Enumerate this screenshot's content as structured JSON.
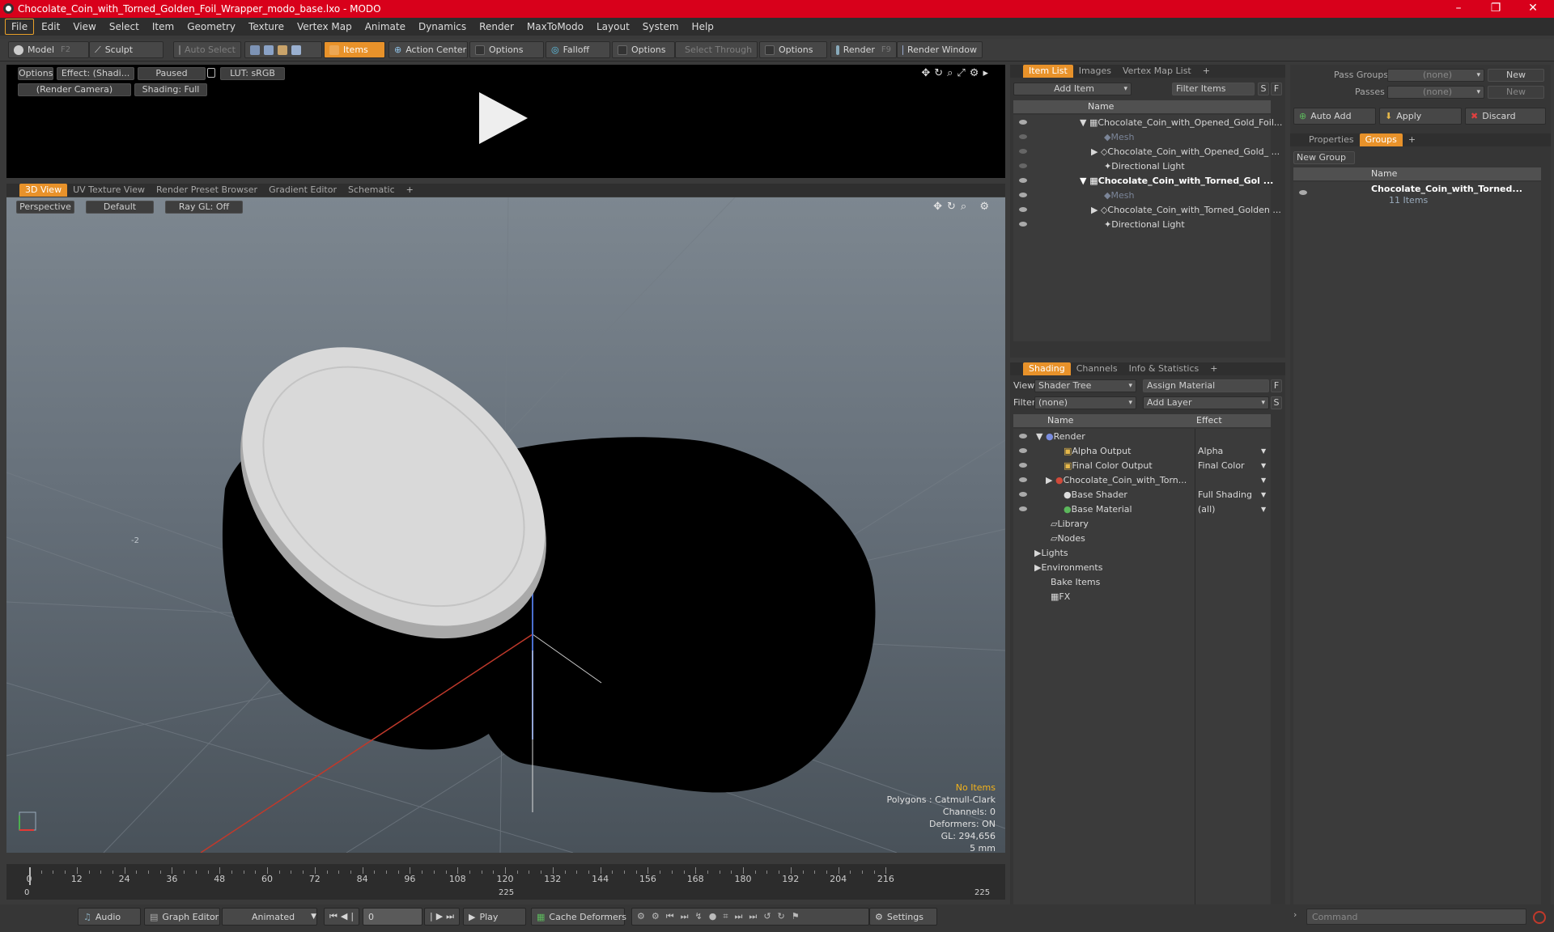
{
  "window": {
    "title": "Chocolate_Coin_with_Torned_Golden_Foil_Wrapper_modo_base.lxo - MODO"
  },
  "menu": [
    "File",
    "Edit",
    "View",
    "Select",
    "Item",
    "Geometry",
    "Texture",
    "Vertex Map",
    "Animate",
    "Dynamics",
    "Render",
    "MaxToModo",
    "Layout",
    "System",
    "Help"
  ],
  "toolbar": {
    "model": "Model",
    "model_key": "F2",
    "sculpt": "Sculpt",
    "auto_select": "Auto Select",
    "items": "Items",
    "action_center": "Action Center",
    "options1": "Options",
    "falloff": "Falloff",
    "options2": "Options",
    "select_through": "Select Through",
    "options3": "Options",
    "render": "Render",
    "render_key": "F9",
    "render_window": "Render Window"
  },
  "preview": {
    "options": "Options",
    "effect": "Effect: (Shadi...",
    "paused": "Paused",
    "lut": "LUT: sRGB",
    "camera": "(Render Camera)",
    "shading": "Shading: Full"
  },
  "viewport_tabs": [
    "3D View",
    "UV Texture View",
    "Render Preset Browser",
    "Gradient Editor",
    "Schematic"
  ],
  "viewport": {
    "view": "Perspective",
    "style": "Default",
    "raygl": "Ray GL: Off",
    "grid_label": "-2",
    "hud": {
      "no_items": "No Items",
      "polygons": "Polygons : Catmull-Clark",
      "channels": "Channels: 0",
      "deformers": "Deformers: ON",
      "gl": "GL: 294,656",
      "unit": "5 mm"
    }
  },
  "item_list": {
    "tabs": [
      "Item List",
      "Images",
      "Vertex Map List"
    ],
    "add_item": "Add Item",
    "filter": "Filter Items",
    "s": "S",
    "f": "F",
    "col_name": "Name",
    "rows": [
      "Chocolate_Coin_with_Opened_Gold_Foil...",
      "Mesh",
      "Chocolate_Coin_with_Opened_Gold_ ...",
      "Directional Light",
      "Chocolate_Coin_with_Torned_Gol ...",
      "Mesh",
      "Chocolate_Coin_with_Torned_Golden ...",
      "Directional Light"
    ]
  },
  "shading": {
    "tabs": [
      "Shading",
      "Channels",
      "Info & Statistics"
    ],
    "view_label": "View",
    "view_value": "Shader Tree",
    "assign": "Assign Material",
    "f": "F",
    "filter_label": "Filter",
    "filter_value": "(none)",
    "add_layer": "Add Layer",
    "s": "S",
    "col_name": "Name",
    "col_effect": "Effect",
    "rows": [
      {
        "name": "Render",
        "effect": ""
      },
      {
        "name": "Alpha Output",
        "effect": "Alpha"
      },
      {
        "name": "Final Color Output",
        "effect": "Final Color"
      },
      {
        "name": "Chocolate_Coin_with_Torn...",
        "effect": ""
      },
      {
        "name": "Base Shader",
        "effect": "Full Shading"
      },
      {
        "name": "Base Material",
        "effect": "(all)"
      },
      {
        "name": "Library",
        "effect": ""
      },
      {
        "name": "Nodes",
        "effect": ""
      },
      {
        "name": "Lights",
        "effect": ""
      },
      {
        "name": "Environments",
        "effect": ""
      },
      {
        "name": "Bake Items",
        "effect": ""
      },
      {
        "name": "FX",
        "effect": ""
      }
    ]
  },
  "groups": {
    "pass_groups": "Pass Groups",
    "passes": "Passes",
    "none1": "(none)",
    "none2": "(none)",
    "new1": "New",
    "new2": "New",
    "auto_add": "Auto Add",
    "apply": "Apply",
    "discard": "Discard",
    "tabs": [
      "Properties",
      "Groups"
    ],
    "new_group": "New Group",
    "col_name": "Name",
    "group_name": "Chocolate_Coin_with_Torned...",
    "group_count": "11 Items"
  },
  "timeline": {
    "ticks": [
      "0",
      "12",
      "24",
      "36",
      "48",
      "60",
      "72",
      "84",
      "96",
      "108",
      "120",
      "132",
      "144",
      "156",
      "168",
      "180",
      "192",
      "204",
      "216"
    ],
    "start": "0",
    "mid": "225",
    "end": "225"
  },
  "bottom": {
    "audio": "Audio",
    "graph_editor": "Graph Editor",
    "animated": "Animated",
    "frame": "0",
    "play": "Play",
    "cache": "Cache Deformers",
    "settings": "Settings",
    "command": "Command"
  }
}
